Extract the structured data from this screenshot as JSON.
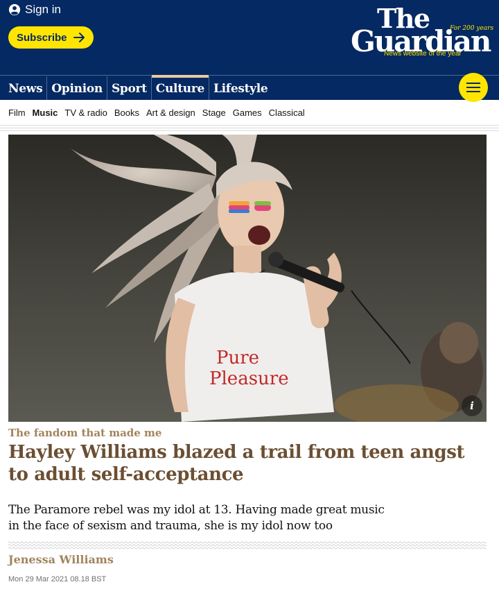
{
  "header": {
    "signin_label": "Sign in",
    "subscribe_label": "Subscribe",
    "logo": {
      "line1": "The",
      "line2": "Guardian",
      "years": "For 200 years",
      "tagline": "News website of the year"
    },
    "pillars": [
      {
        "label": "News",
        "active": false
      },
      {
        "label": "Opinion",
        "active": false
      },
      {
        "label": "Sport",
        "active": false
      },
      {
        "label": "Culture",
        "active": true
      },
      {
        "label": "Lifestyle",
        "active": false
      }
    ],
    "menu_icon": "hamburger-icon"
  },
  "subnav": {
    "items": [
      {
        "label": "Film",
        "active": false
      },
      {
        "label": "Music",
        "active": true
      },
      {
        "label": "TV & radio",
        "active": false
      },
      {
        "label": "Books",
        "active": false
      },
      {
        "label": "Art & design",
        "active": false
      },
      {
        "label": "Stage",
        "active": false
      },
      {
        "label": "Games",
        "active": false
      },
      {
        "label": "Classical",
        "active": false
      }
    ]
  },
  "hero": {
    "shirt_text_line1": "Pure",
    "shirt_text_line2": "Pleasure",
    "info_label": "i"
  },
  "article": {
    "series": "The fandom that made me",
    "headline": "Hayley Williams blazed a trail from teen angst to adult self-acceptance",
    "standfirst": "The Paramore rebel was my idol at 13. Having made great music in the face of sexism and trauma, she is my idol now too",
    "byline": "Jenessa Williams",
    "date": "Mon 29 Mar 2021 08.18 BST"
  },
  "colors": {
    "brand_blue": "#052962",
    "yellow": "#ffe500",
    "culture_accent": "#a1845c",
    "headline": "#6b4f32"
  }
}
